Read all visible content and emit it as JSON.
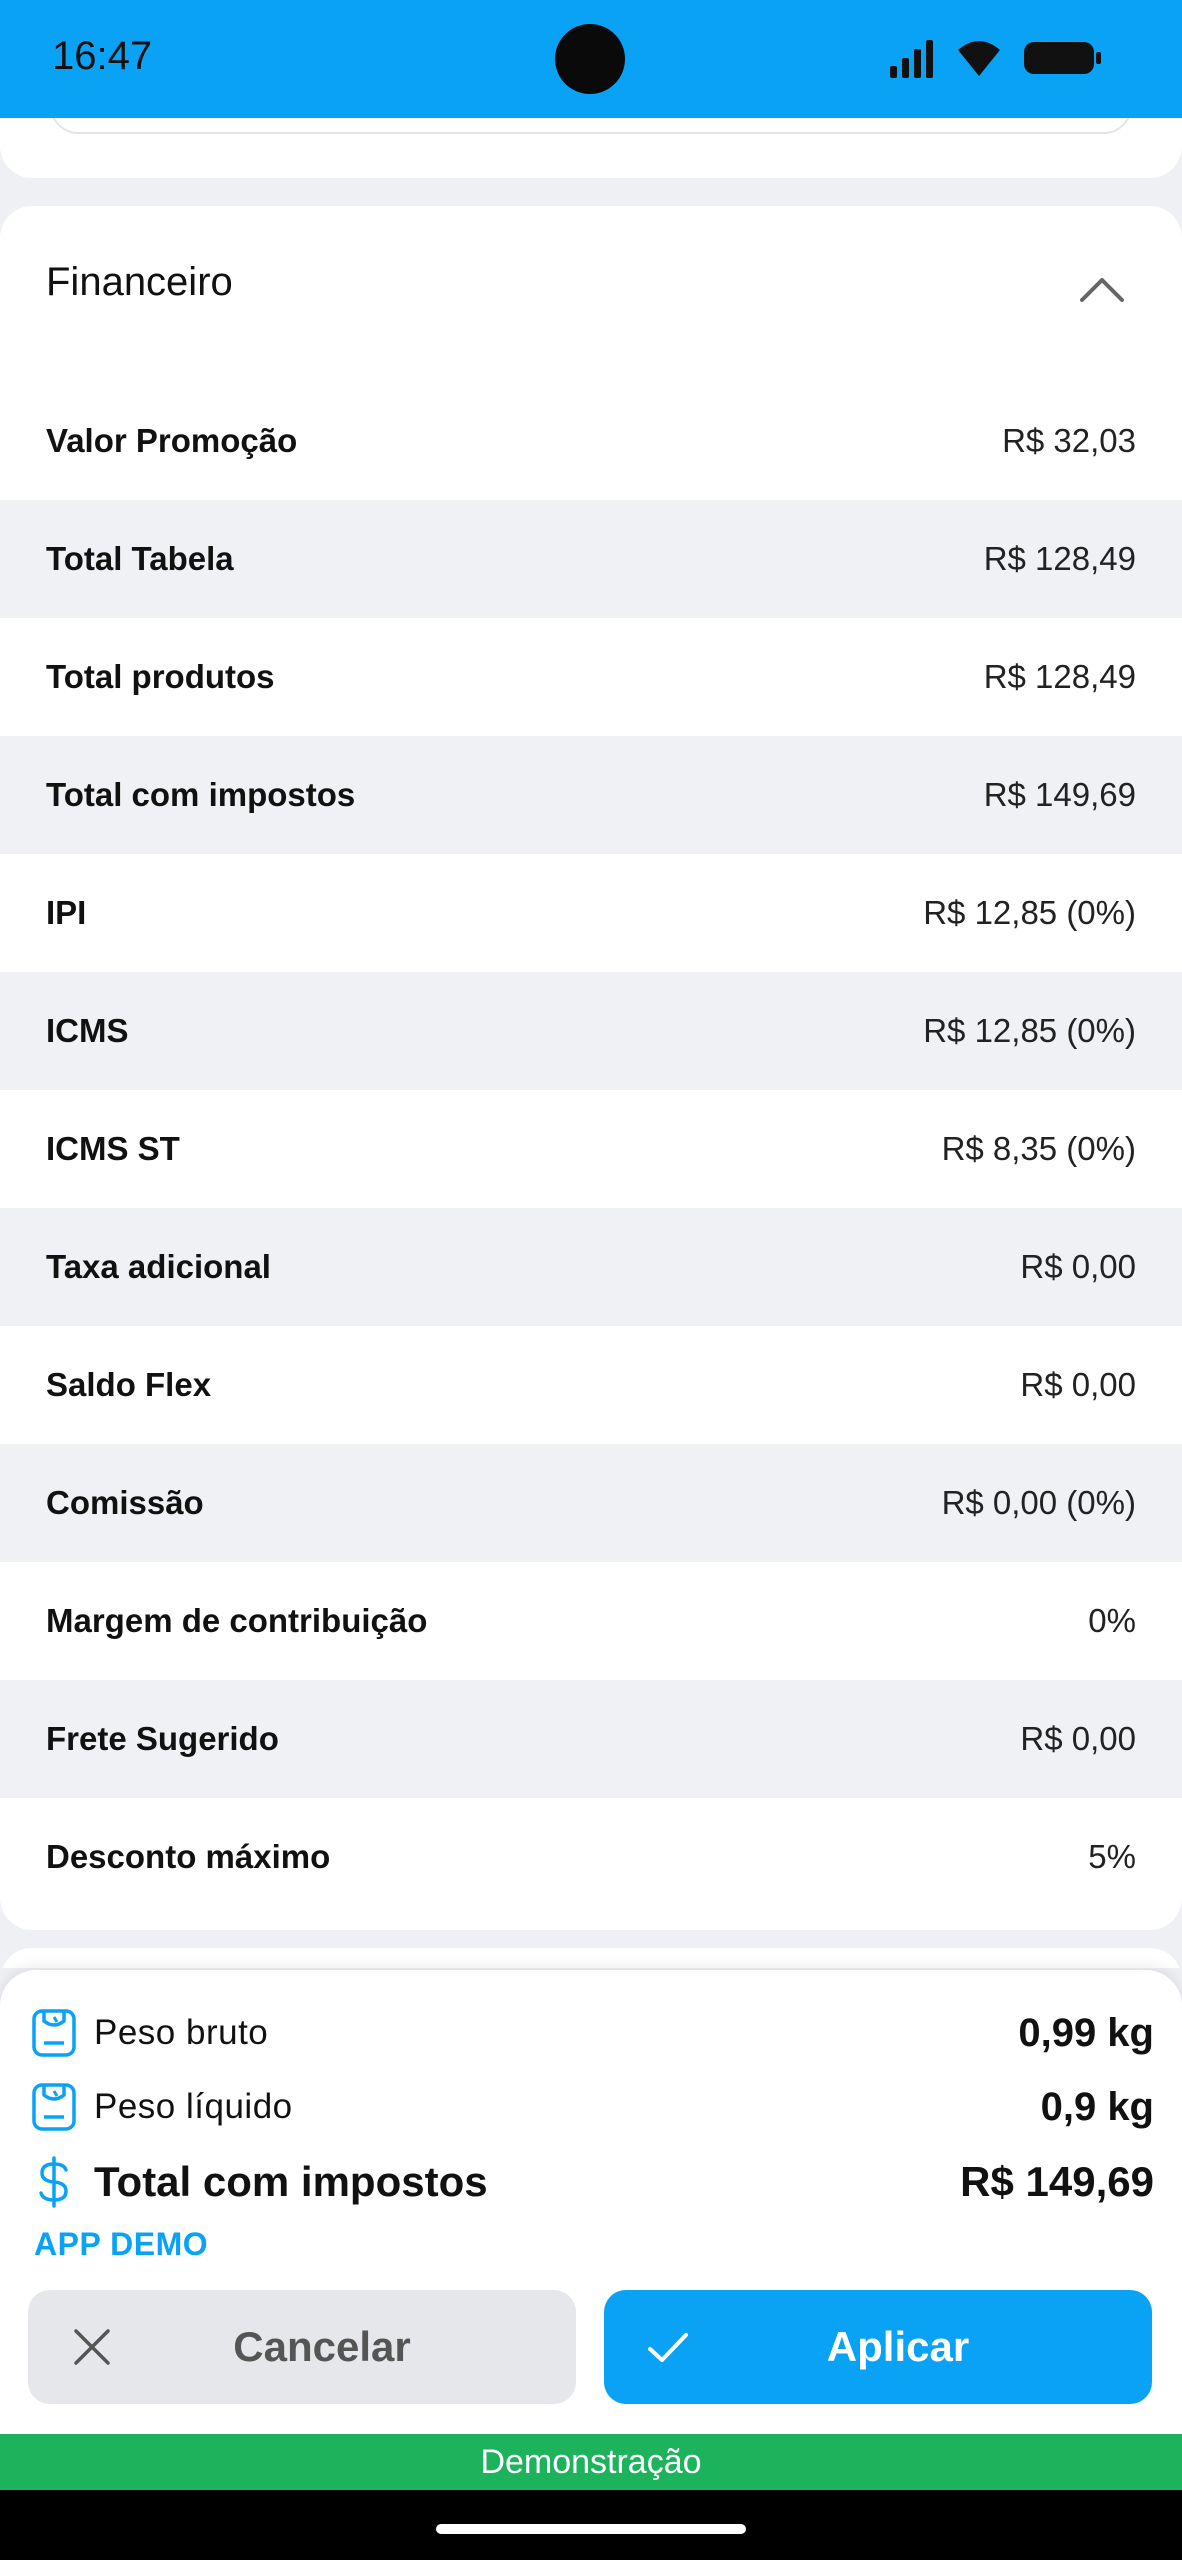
{
  "status_bar": {
    "time": "16:47",
    "icons": [
      "signal-icon",
      "wifi-icon",
      "battery-icon"
    ]
  },
  "financeiro": {
    "title": "Financeiro",
    "collapse_icon": "chevron-up-icon",
    "rows": [
      {
        "label": "Valor Promoção",
        "value": "R$ 32,03"
      },
      {
        "label": "Total Tabela",
        "value": "R$ 128,49"
      },
      {
        "label": "Total produtos",
        "value": "R$ 128,49"
      },
      {
        "label": "Total com impostos",
        "value": "R$ 149,69"
      },
      {
        "label": "IPI",
        "value": "R$ 12,85 (0%)"
      },
      {
        "label": "ICMS",
        "value": "R$ 12,85 (0%)"
      },
      {
        "label": "ICMS ST",
        "value": "R$ 8,35 (0%)"
      },
      {
        "label": "Taxa adicional",
        "value": "R$ 0,00"
      },
      {
        "label": "Saldo Flex",
        "value": "R$ 0,00"
      },
      {
        "label": "Comissão",
        "value": "R$ 0,00 (0%)"
      },
      {
        "label": "Margem de contribuição",
        "value": "0%"
      },
      {
        "label": "Frete Sugerido",
        "value": "R$ 0,00"
      },
      {
        "label": "Desconto máximo",
        "value": "5%"
      }
    ]
  },
  "summary": {
    "peso_bruto": {
      "label": "Peso bruto",
      "value": "0,99 kg",
      "icon": "scale-icon"
    },
    "peso_liquido": {
      "label": "Peso líquido",
      "value": "0,9 kg",
      "icon": "scale-icon"
    },
    "total": {
      "label": "Total com impostos",
      "value": "R$ 149,69",
      "icon": "dollar-icon"
    },
    "app_demo": "APP DEMO"
  },
  "actions": {
    "cancel_label": "Cancelar",
    "cancel_icon": "close-icon",
    "apply_label": "Aplicar",
    "apply_icon": "check-icon"
  },
  "demo_banner": "Demonstração",
  "colors": {
    "accent": "#0aa2f5",
    "demo_green": "#1db25c",
    "row_alt": "#eff1f4"
  }
}
